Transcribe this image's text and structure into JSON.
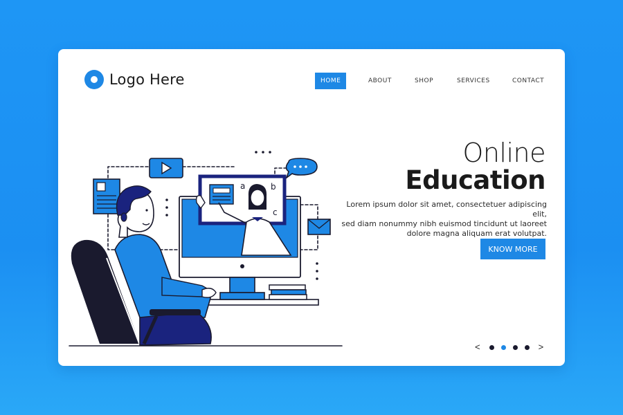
{
  "logo": {
    "text": "Logo Here",
    "icon": "circle-logo-icon"
  },
  "nav": {
    "items": [
      {
        "label": "HOME",
        "active": true
      },
      {
        "label": "ABOUT",
        "active": false
      },
      {
        "label": "SHOP",
        "active": false
      },
      {
        "label": "SERVICES",
        "active": false
      },
      {
        "label": "CONTACT",
        "active": false
      }
    ]
  },
  "hero": {
    "title_line1": "Online",
    "title_line2": "Education",
    "body_lines": [
      "Lorem ipsum dolor sit amet, consectetuer adipiscing elit,",
      "sed diam nonummy nibh euismod tincidunt ut laoreet",
      "dolore magna aliquam erat volutpat."
    ],
    "cta_label": "KNOW MORE"
  },
  "illustration": {
    "letters": {
      "a": "a",
      "b": "b",
      "c": "c"
    }
  },
  "pager": {
    "prev": "<",
    "next": ">",
    "total": 4,
    "active_index": 1
  },
  "colors": {
    "accent": "#1e88e5",
    "background_top": "#1e96f5",
    "navy": "#1a237e",
    "text": "#1a1a1a"
  }
}
